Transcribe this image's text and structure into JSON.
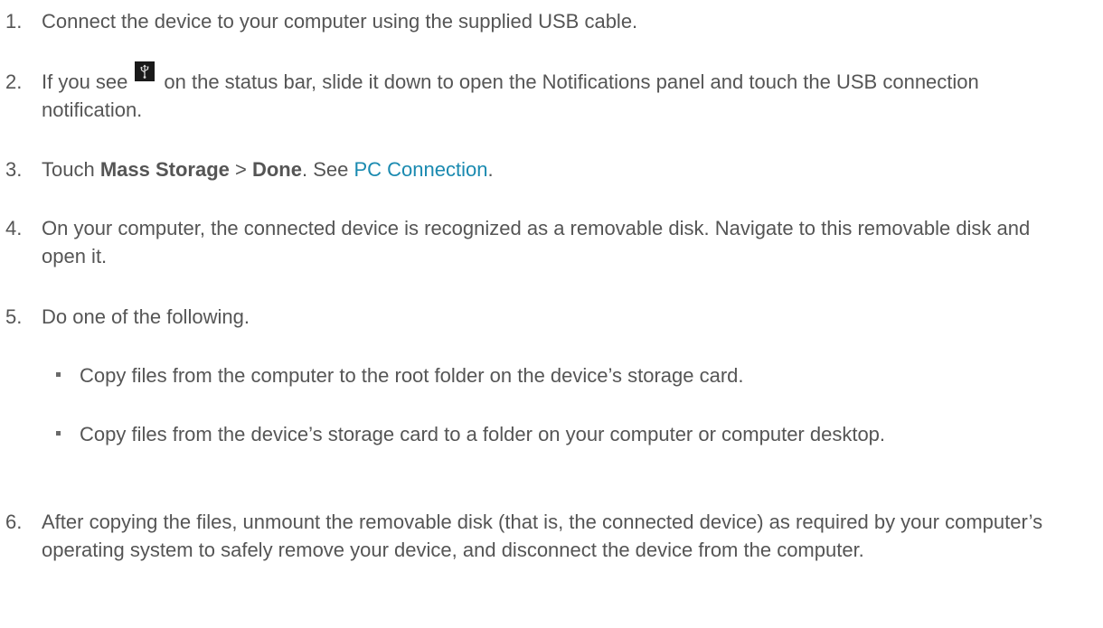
{
  "steps": [
    {
      "num": "1.",
      "text": "Connect the device to your computer using the supplied USB cable."
    },
    {
      "num": "2.",
      "pre": "If you see",
      "post": "on the status bar, slide it down to open the Notifications panel and touch the USB connection notification.",
      "icon": "usb-icon"
    },
    {
      "num": "3.",
      "pre": "Touch ",
      "bold1": "Mass Storage",
      "sep": " > ",
      "bold2": "Done",
      "mid": ". See ",
      "link": "PC Connection",
      "end": "."
    },
    {
      "num": "4.",
      "text": "On your computer, the connected device is recognized as a removable disk. Navigate to this removable disk and open it."
    },
    {
      "num": "5.",
      "text": "Do one of the following.",
      "bullets": [
        "Copy files from the computer to the root folder on the device’s storage card.",
        "Copy files from the device’s storage card to a folder on your computer or computer desktop."
      ]
    },
    {
      "num": "6.",
      "text": "After copying the files, unmount the removable disk (that is, the connected device) as required by your computer’s operating system to safely remove your device, and disconnect the device from the computer."
    }
  ],
  "colors": {
    "text": "#555555",
    "link": "#1a8ab0",
    "icon_bg": "#1a1a1a"
  }
}
